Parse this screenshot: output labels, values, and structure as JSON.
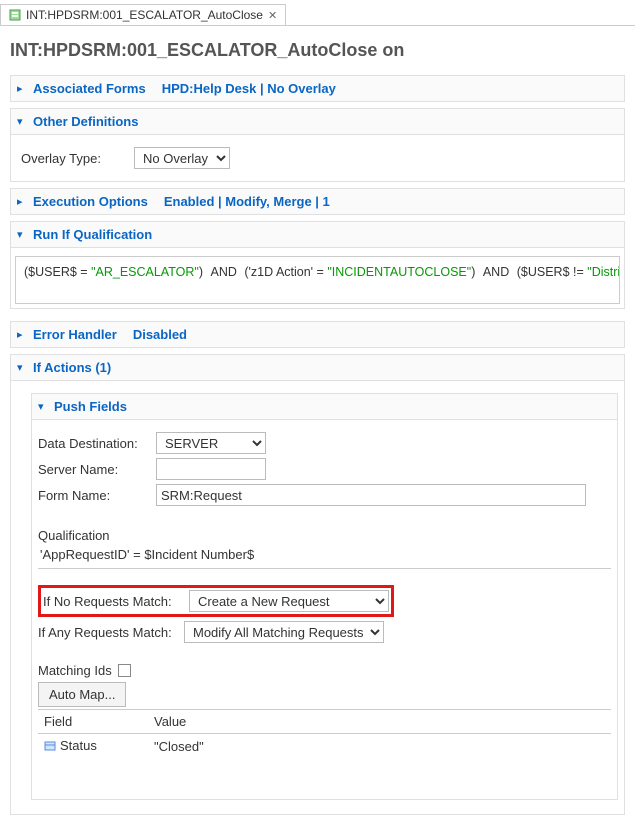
{
  "tab": {
    "title": "INT:HPDSRM:001_ESCALATOR_AutoClose"
  },
  "page_title": "INT:HPDSRM:001_ESCALATOR_AutoClose on",
  "sections": {
    "associated_forms": {
      "label": "Associated Forms",
      "extra": "HPD:Help Desk | No Overlay"
    },
    "other_definitions": {
      "label": "Other Definitions",
      "overlay_type_label": "Overlay Type:",
      "overlay_type_value": "No Overlay"
    },
    "execution_options": {
      "label": "Execution Options",
      "extra": "Enabled | Modify, Merge | 1"
    },
    "run_if": {
      "label": "Run If Qualification",
      "pairs": [
        {
          "lhs": "$USER$",
          "rhs": "\"AR_ESCALATOR\""
        },
        {
          "lhs": "'z1D Action'",
          "rhs": "\"INCIDENTAUTOCLOSE\""
        },
        {
          "lhs": "$USER$",
          "op": "!=",
          "rhs": "\"Distributed Server\""
        }
      ]
    },
    "error_handler": {
      "label": "Error Handler",
      "extra": "Disabled"
    },
    "if_actions": {
      "label": "If Actions (1)",
      "push_fields": {
        "label": "Push Fields",
        "data_destination_label": "Data Destination:",
        "data_destination_value": "SERVER",
        "server_name_label": "Server Name:",
        "server_name_value": "",
        "form_name_label": "Form Name:",
        "form_name_value": "SRM:Request",
        "qualification_label": "Qualification",
        "qualification_text": "'AppRequestID' = $Incident Number$",
        "no_match_label": "If No Requests Match:",
        "no_match_value": "Create a New Request",
        "any_match_label": "If Any Requests Match:",
        "any_match_value": "Modify All Matching Requests",
        "matching_ids_label": "Matching Ids",
        "auto_map_label": "Auto Map...",
        "table": {
          "field_header": "Field",
          "value_header": "Value",
          "rows": [
            {
              "field": "Status",
              "value": "\"Closed\""
            }
          ]
        }
      }
    }
  }
}
